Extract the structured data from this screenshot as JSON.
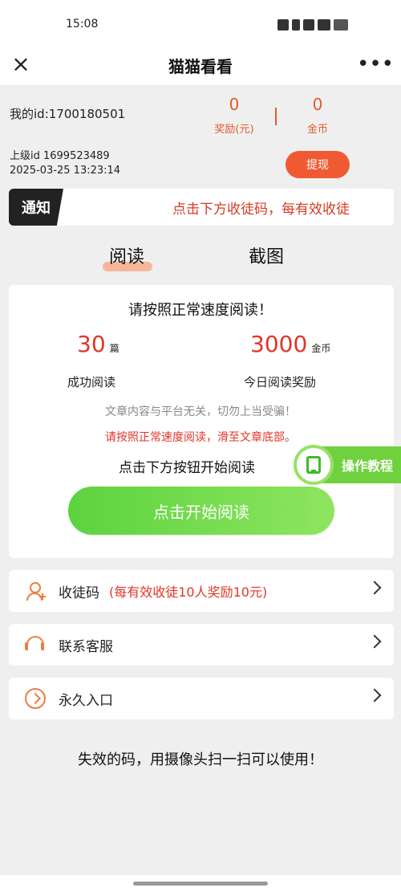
{
  "status_bar": {
    "time": "15:08"
  },
  "header": {
    "title": "猫猫看看"
  },
  "account": {
    "my_id": "我的id:1700180501",
    "reward_value": "0",
    "reward_label": "奖励(元)",
    "coin_value": "0",
    "coin_label": "金币",
    "parent_id": "上级id 1699523489",
    "timestamp": "2025-03-25 13:23:14",
    "withdraw_label": "提现"
  },
  "notice": {
    "badge": "通知",
    "text": "点击下方收徒码，每有效收徒"
  },
  "tabs": [
    "阅读",
    "截图"
  ],
  "reading_card": {
    "heading": "请按照正常速度阅读！",
    "articles_value": "30",
    "articles_unit": "篇",
    "articles_label": "成功阅读",
    "coins_value": "3000",
    "coins_unit": "金币",
    "coins_label": "今日阅读奖励",
    "disclaimer": "文章内容与平台无关，切勿上当受骗！",
    "warning": "请按照正常速度阅读，滑至文章底部。",
    "instruction": "点击下方按钮开始阅读",
    "tutorial_label": "操作教程",
    "start_button": "点击开始阅读"
  },
  "menu": [
    {
      "icon": "person-add-icon",
      "label": "收徒码",
      "extra": "(每有效收徒10人奖励10元)"
    },
    {
      "icon": "headset-icon",
      "label": "联系客服",
      "extra": ""
    },
    {
      "icon": "enter-icon",
      "label": "永久入口",
      "extra": ""
    }
  ],
  "footer_note": "失效的码，用摄像头扫一扫可以使用！"
}
